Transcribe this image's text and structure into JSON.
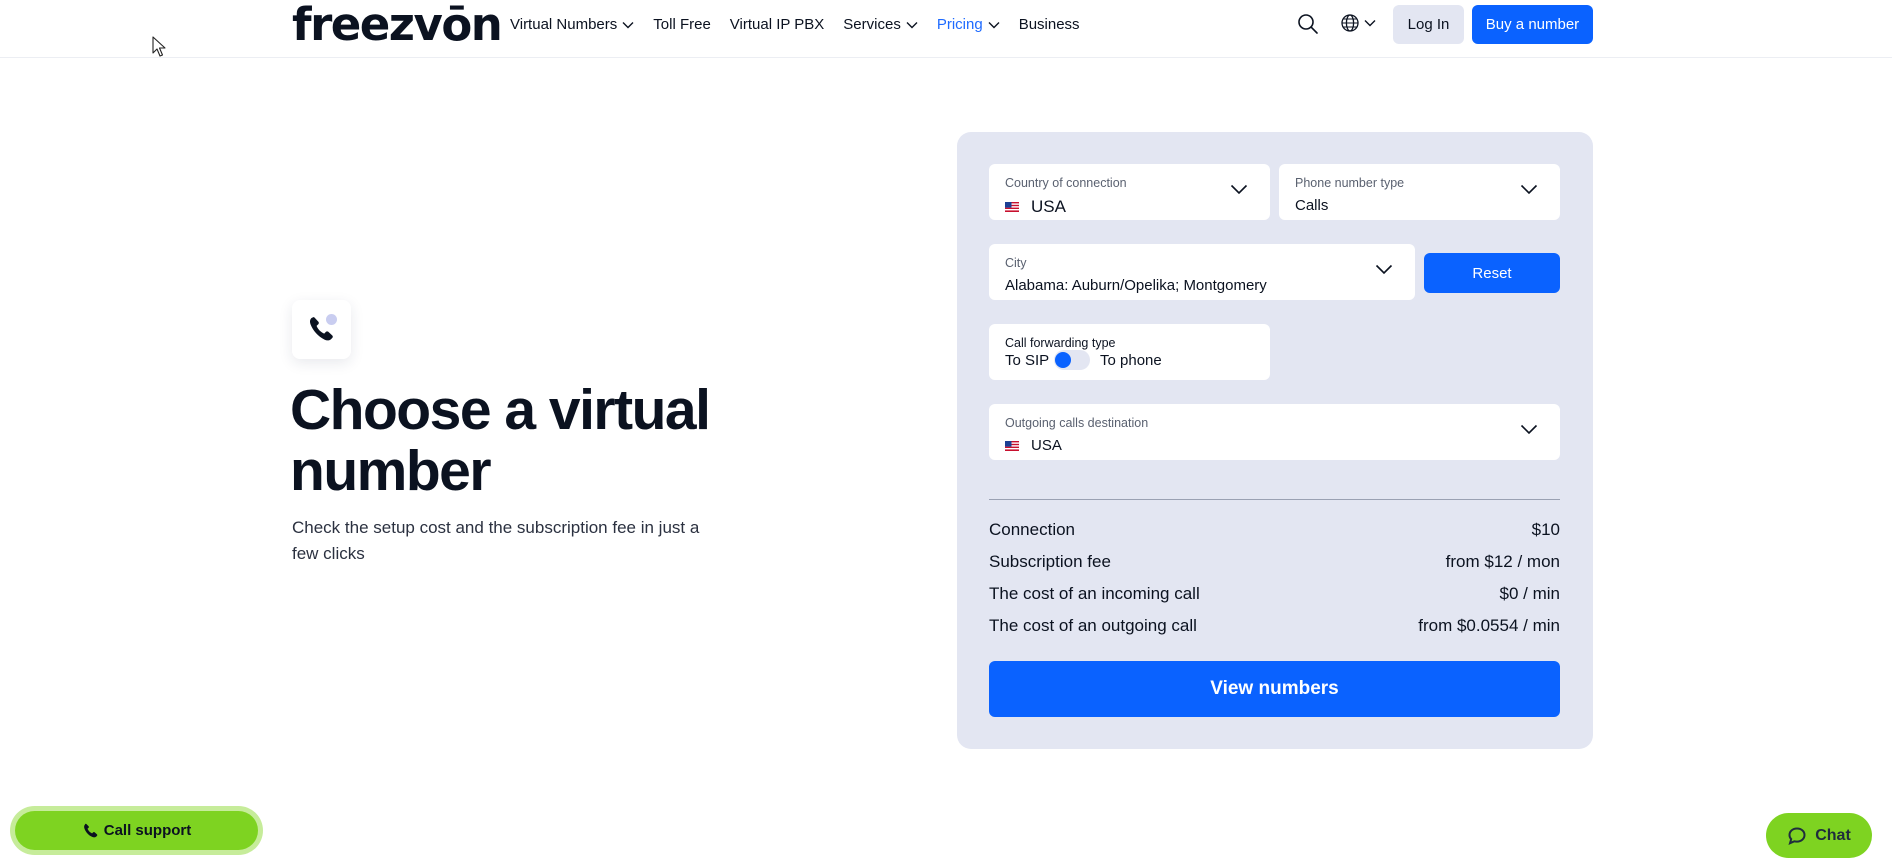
{
  "header": {
    "logo_text": "freezvōn",
    "nav": [
      {
        "label": "Virtual Numbers",
        "has_dropdown": true,
        "active": false
      },
      {
        "label": "Toll Free",
        "has_dropdown": false,
        "active": false
      },
      {
        "label": "Virtual IP PBX",
        "has_dropdown": false,
        "active": false
      },
      {
        "label": "Services",
        "has_dropdown": true,
        "active": false
      },
      {
        "label": "Pricing",
        "has_dropdown": true,
        "active": true
      },
      {
        "label": "Business",
        "has_dropdown": false,
        "active": false
      }
    ],
    "search_icon": "search-icon",
    "language_icon": "globe-icon",
    "login_label": "Log In",
    "buy_label": "Buy a number"
  },
  "hero": {
    "icon": "phone-icon",
    "title": "Choose a virtual number",
    "subtitle": "Check the setup cost and the subscription fee in just a few clicks"
  },
  "calculator": {
    "country": {
      "label": "Country of connection",
      "value": "USA",
      "flag_icon": "us-flag-icon"
    },
    "number_type": {
      "label": "Phone number type",
      "value": "Calls"
    },
    "city": {
      "label": "City",
      "value": "Alabama: Auburn/Opelika; Montgomery"
    },
    "reset_label": "Reset",
    "forwarding": {
      "label": "Call forwarding type",
      "left": "To SIP",
      "right": "To phone",
      "selected": "To SIP"
    },
    "outgoing": {
      "label": "Outgoing calls destination",
      "value": "USA",
      "flag_icon": "us-flag-icon"
    },
    "prices": [
      {
        "label": "Connection",
        "value": "$10"
      },
      {
        "label": "Subscription fee",
        "value": "from $12 / mon"
      },
      {
        "label": "The cost of an incoming call",
        "value": "$0 / min"
      },
      {
        "label": "The cost of an outgoing call",
        "value": "from $0.0554 / min"
      }
    ],
    "view_label": "View numbers"
  },
  "widgets": {
    "support_label": "Call support",
    "chat_label": "Chat"
  },
  "colors": {
    "accent": "#0a62ff",
    "card_bg": "#e3e6f2",
    "green": "#7ed321",
    "active_nav": "#1f6bff"
  }
}
